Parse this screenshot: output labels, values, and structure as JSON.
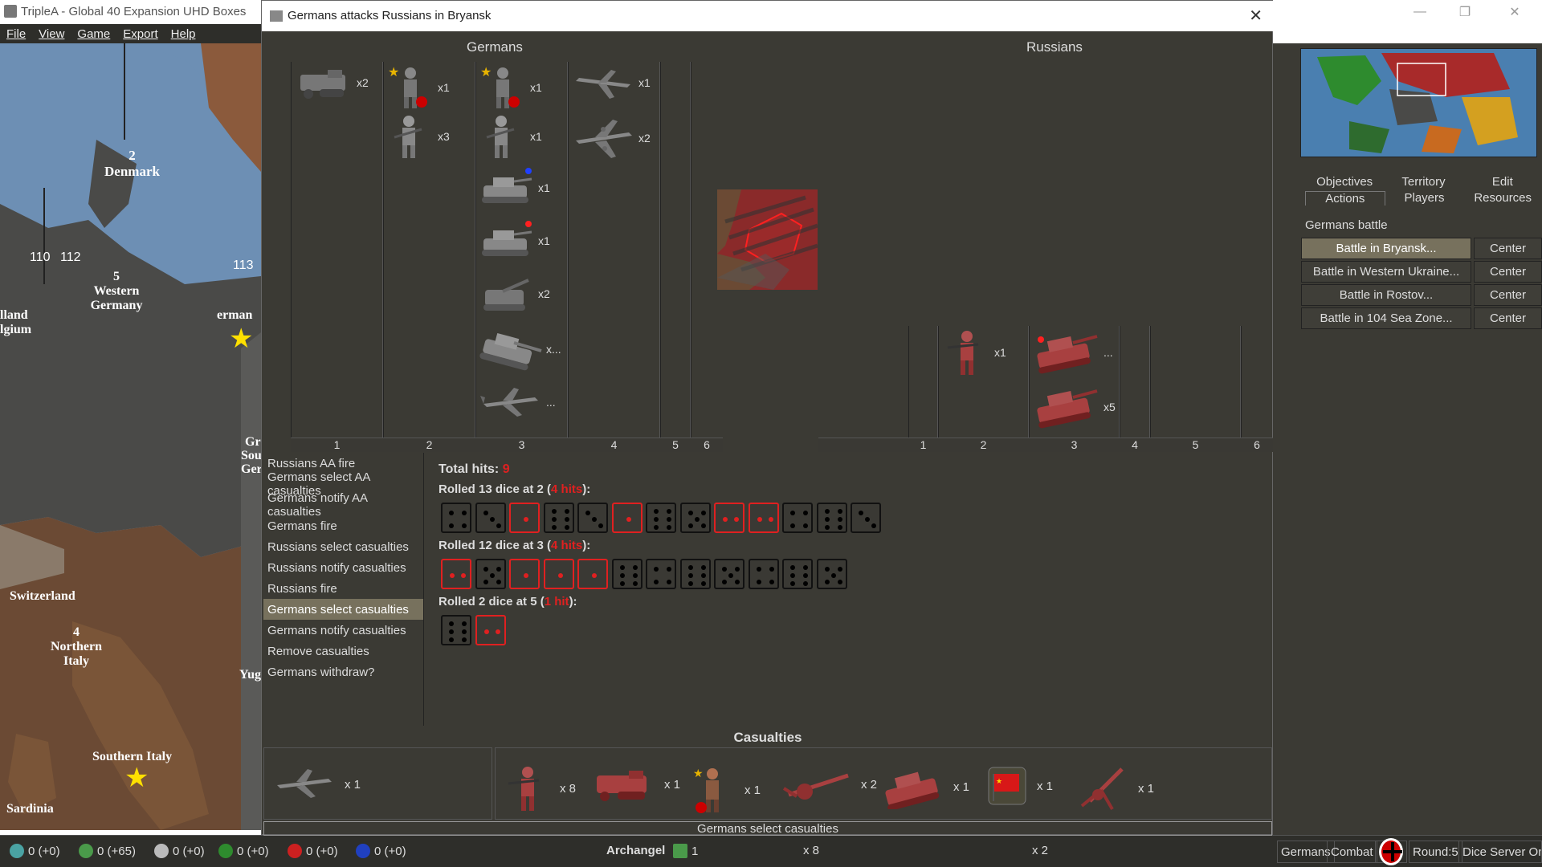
{
  "window": {
    "title": "TripleA - Global 40 Expansion UHD Boxes"
  },
  "menu": {
    "items": [
      "File",
      "View",
      "Game",
      "Export",
      "Help"
    ]
  },
  "map": {
    "labels": [
      {
        "text": "Denmark",
        "num": "2"
      },
      {
        "text": "Western Germany",
        "num": "5"
      },
      {
        "text": "Switzerland"
      },
      {
        "text": "Northern Italy",
        "num": "4"
      },
      {
        "text": "Southern Italy"
      },
      {
        "text": "Sardinia"
      }
    ],
    "sea_numbers": [
      "110",
      "112",
      "113"
    ],
    "fragments": [
      "lland",
      "lgium",
      "erman",
      "Gr",
      "Sou",
      "Ger",
      "Yug"
    ]
  },
  "dialog": {
    "title": "Germans attacks Russians in Bryansk",
    "attacker": "Germans",
    "defender": "Russians",
    "attacker_columns": [
      "1",
      "2",
      "3",
      "4",
      "5",
      "6"
    ],
    "defender_columns": [
      "1",
      "2",
      "3",
      "4",
      "5",
      "6"
    ],
    "attacker_units": {
      "c1": [
        {
          "icon": "halftrack-icon",
          "count": "x2"
        }
      ],
      "c2": [
        {
          "icon": "general-icon",
          "count": "x1"
        },
        {
          "icon": "infantry-icon",
          "count": "x3"
        }
      ],
      "c3": [
        {
          "icon": "general-icon",
          "count": "x1"
        },
        {
          "icon": "infantry-icon",
          "count": "x1"
        },
        {
          "icon": "tank-icon",
          "count": "x1"
        },
        {
          "icon": "tank-icon",
          "count": "x1"
        },
        {
          "icon": "artillery-icon",
          "count": "x2"
        },
        {
          "icon": "heavy-tank-icon",
          "count": "x..."
        },
        {
          "icon": "fighter-icon",
          "count": "..."
        }
      ],
      "c4": [
        {
          "icon": "fighter-icon",
          "count": "x1"
        },
        {
          "icon": "bomber-icon",
          "count": "x2"
        }
      ]
    },
    "defender_units": {
      "c2": [
        {
          "icon": "infantry-icon",
          "count": "x1"
        }
      ],
      "c3": [
        {
          "icon": "tank-icon",
          "count": "..."
        },
        {
          "icon": "tank-icon",
          "count": "x5"
        }
      ]
    },
    "steps": [
      "Russians AA fire",
      "Germans select AA casualties",
      "Germans notify AA casualties",
      "Germans fire",
      "Russians select casualties",
      "Russians notify casualties",
      "Russians fire",
      "Germans select casualties",
      "Germans notify casualties",
      "Remove casualties",
      "Germans withdraw?"
    ],
    "selected_step": "Germans select casualties",
    "total_hits_label": "Total hits:",
    "total_hits_value": "9",
    "rolls": [
      {
        "prefix": "Rolled 13 dice at 2 (",
        "hits": "4 hits",
        "suffix": "):",
        "dice": [
          4,
          3,
          1,
          6,
          3,
          1,
          6,
          5,
          2,
          2,
          4,
          6,
          3
        ],
        "hit_flags": [
          0,
          0,
          1,
          0,
          0,
          1,
          0,
          0,
          1,
          1,
          0,
          0,
          0
        ]
      },
      {
        "prefix": "Rolled 12 dice at 3 (",
        "hits": "4 hits",
        "suffix": "):",
        "dice": [
          2,
          5,
          1,
          1,
          1,
          6,
          4,
          6,
          5,
          4,
          6,
          5
        ],
        "hit_flags": [
          1,
          0,
          1,
          1,
          1,
          0,
          0,
          0,
          0,
          0,
          0,
          0
        ]
      },
      {
        "prefix": "Rolled 2 dice at 5 (",
        "hits": "1 hit",
        "suffix": "):",
        "dice": [
          6,
          2
        ],
        "hit_flags": [
          0,
          1
        ]
      }
    ],
    "casualties_title": "Casualties",
    "casualties_attacker": [
      {
        "icon": "fighter-icon",
        "count": "x 1"
      }
    ],
    "casualties_defender": [
      {
        "icon": "infantry-icon",
        "count": "x 8"
      },
      {
        "icon": "halftrack-icon",
        "count": "x 1"
      },
      {
        "icon": "general-icon",
        "count": "x 1"
      },
      {
        "icon": "artillery-icon",
        "count": "x 2"
      },
      {
        "icon": "tank-icon",
        "count": "x 1"
      },
      {
        "icon": "flag-icon",
        "count": "x 1"
      },
      {
        "icon": "aa-gun-icon",
        "count": "x 1"
      }
    ],
    "status": "Germans select  casualties"
  },
  "right_panel": {
    "tabs_row1": [
      "Objectives",
      "Territory",
      "Edit"
    ],
    "tabs_row2": [
      "Actions",
      "Players",
      "Resources"
    ],
    "active_tab": "Actions",
    "section_label": "Germans battle",
    "battles": [
      {
        "label": "Battle in Bryansk...",
        "center": "Center",
        "selected": true
      },
      {
        "label": "Battle in Western Ukraine...",
        "center": "Center",
        "selected": false
      },
      {
        "label": "Battle in Rostov...",
        "center": "Center",
        "selected": false
      },
      {
        "label": "Battle in 104 Sea Zone...",
        "center": "Center",
        "selected": false
      }
    ]
  },
  "bottom_bar": {
    "resources": [
      {
        "icon": "flask-icon",
        "value": "0 (+0)",
        "color": "#4aa3a3"
      },
      {
        "icon": "money-icon",
        "value": "0 (+65)",
        "color": "#4a9a4a"
      },
      {
        "icon": "skull-icon",
        "value": "0 (+0)",
        "color": "#bbbbbb"
      },
      {
        "icon": "green-token-icon",
        "value": "0 (+0)",
        "color": "#2e8b2e"
      },
      {
        "icon": "red-token-icon",
        "value": "0 (+0)",
        "color": "#cc2020"
      },
      {
        "icon": "blue-token-icon",
        "value": "0 (+0)",
        "color": "#2040c0"
      }
    ],
    "territory": "Archangel",
    "territory_count": "1",
    "unit_counts": [
      "x 8",
      "x 2"
    ],
    "player": "Germans",
    "phase": "Combat",
    "round": "Round:5",
    "dice_server": "Dice Server On"
  },
  "colors": {
    "panel": "#3b3a34",
    "selected": "#77715d",
    "hit": "#e02020",
    "russian": "#a83a3a"
  }
}
